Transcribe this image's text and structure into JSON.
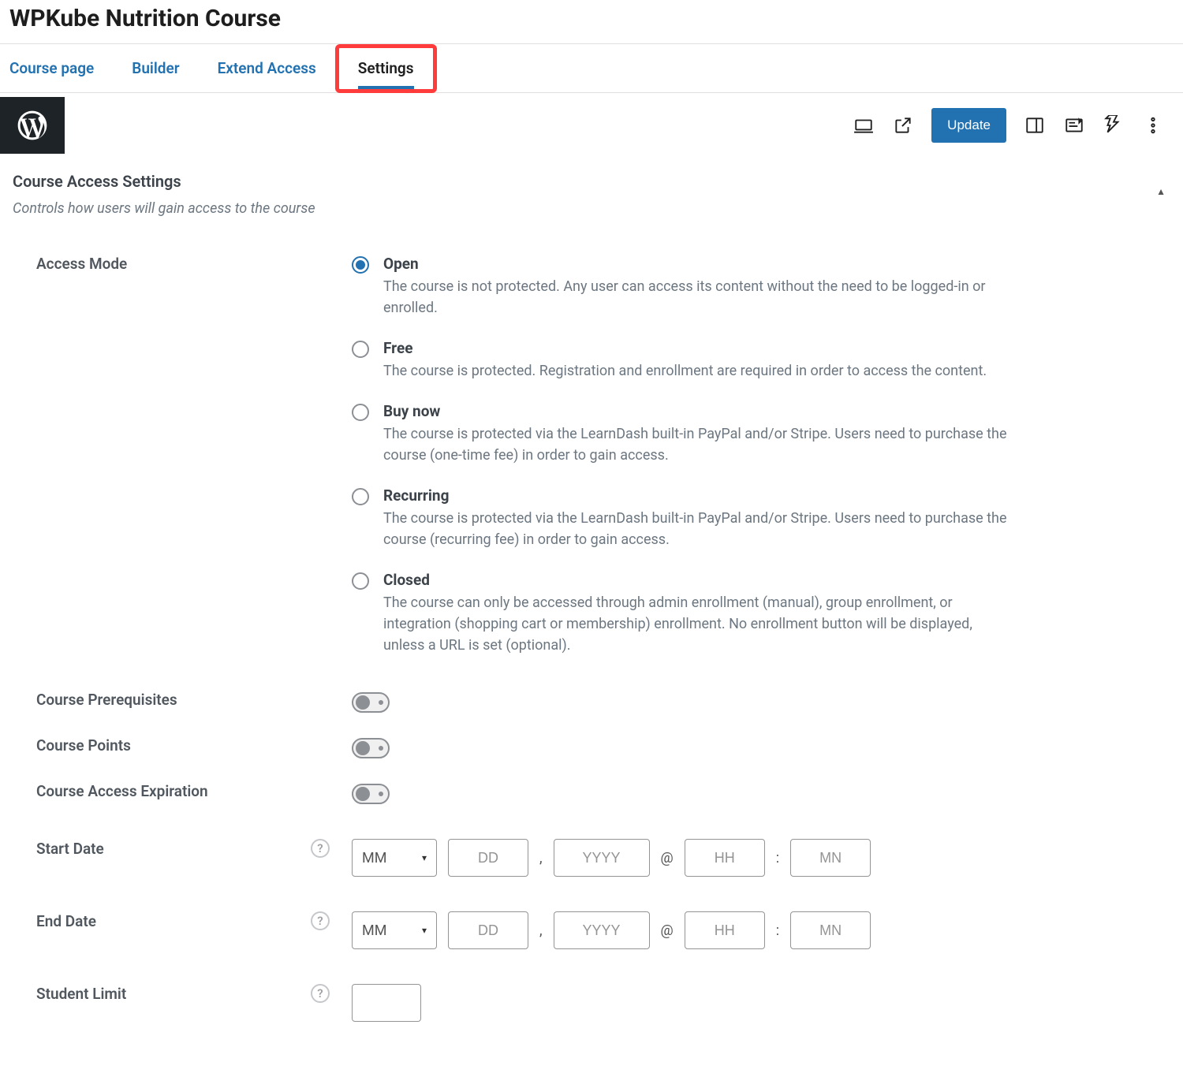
{
  "page_title": "WPKube Nutrition Course",
  "tabs": {
    "course_page": "Course page",
    "builder": "Builder",
    "extend_access": "Extend Access",
    "settings": "Settings"
  },
  "toolbar": {
    "update_label": "Update"
  },
  "section": {
    "title": "Course Access Settings",
    "desc": "Controls how users will gain access to the course"
  },
  "access_mode": {
    "label": "Access Mode",
    "options": {
      "open": {
        "title": "Open",
        "desc": "The course is not protected. Any user can access its content without the need to be logged-in or enrolled."
      },
      "free": {
        "title": "Free",
        "desc": "The course is protected. Registration and enrollment are required in order to access the content."
      },
      "buy_now": {
        "title": "Buy now",
        "desc": "The course is protected via the LearnDash built-in PayPal and/or Stripe. Users need to purchase the course (one-time fee) in order to gain access."
      },
      "recurring": {
        "title": "Recurring",
        "desc": "The course is protected via the LearnDash built-in PayPal and/or Stripe. Users need to purchase the course (recurring fee) in order to gain access."
      },
      "closed": {
        "title": "Closed",
        "desc": "The course can only be accessed through admin enrollment (manual), group enrollment, or integration (shopping cart or membership) enrollment. No enrollment button will be displayed, unless a URL is set (optional)."
      }
    }
  },
  "fields": {
    "prerequisites": "Course Prerequisites",
    "points": "Course Points",
    "expiration": "Course Access Expiration",
    "start_date": "Start Date",
    "end_date": "End Date",
    "student_limit": "Student Limit"
  },
  "date": {
    "mm": "MM",
    "dd": "DD",
    "yyyy": "YYYY",
    "hh": "HH",
    "mn": "MN",
    "comma": ",",
    "at": "@",
    "colon": ":"
  },
  "help_glyph": "?"
}
